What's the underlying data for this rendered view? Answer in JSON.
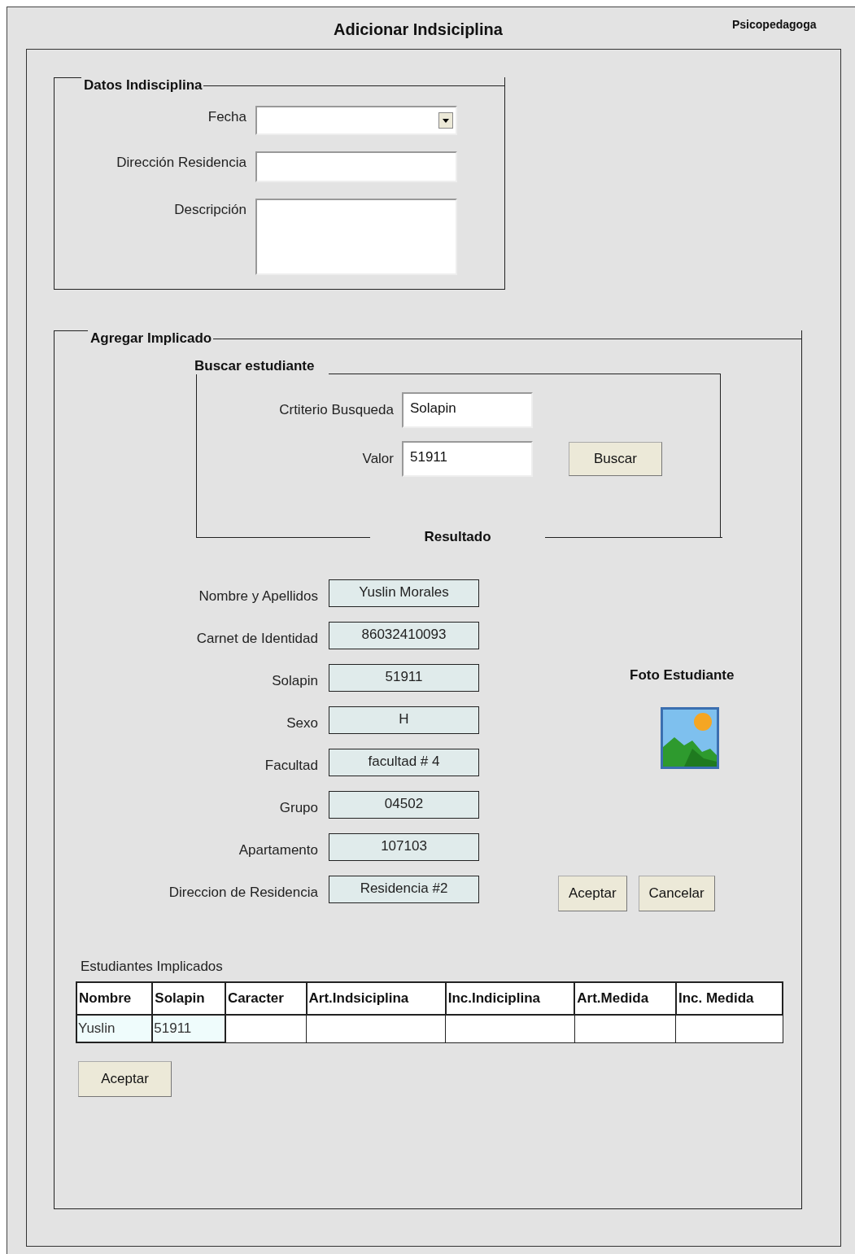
{
  "window": {
    "title": "Adicionar Indsiciplina",
    "role": "Psicopedagoga"
  },
  "datos": {
    "legend": "Datos Indisciplina",
    "fields": [
      {
        "label": "Fecha",
        "kind": "select"
      },
      {
        "label": "Dirección Residencia",
        "kind": "text"
      },
      {
        "label": "Descripción",
        "kind": "textarea"
      }
    ]
  },
  "agregar": {
    "legend": "Agregar Implicado",
    "buscar": {
      "legend": "Buscar estudiante",
      "footer": "Resultado",
      "fields": [
        {
          "label": "Crtiterio Busqueda",
          "value": "Solapin"
        },
        {
          "label": "Valor",
          "value": "51911"
        }
      ],
      "button": "Buscar"
    },
    "resultado": [
      {
        "label": "Nombre y Apellidos",
        "value": "Yuslin Morales"
      },
      {
        "label": "Carnet de Identidad",
        "value": "86032410093"
      },
      {
        "label": "Solapin",
        "value": "51911"
      },
      {
        "label": "Sexo",
        "value": "H"
      },
      {
        "label": "Facultad",
        "value": "facultad # 4"
      },
      {
        "label": "Grupo",
        "value": "04502"
      },
      {
        "label": "Apartamento",
        "value": "107103"
      },
      {
        "label": "Direccion de Residencia",
        "value": "Residencia #2"
      }
    ],
    "foto_label": "Foto Estudiante",
    "buttons": [
      "Aceptar",
      "Cancelar"
    ],
    "table": {
      "caption": "Estudiantes Implicados",
      "columns": [
        "Nombre",
        "Solapin",
        "Caracter",
        "Art.Indsiciplina",
        "Inc.Indiciplina",
        "Art.Medida",
        "Inc. Medida"
      ],
      "rows": [
        {
          "cells": [
            "Yuslin",
            "51911"
          ]
        }
      ]
    },
    "submit": "Aceptar"
  }
}
